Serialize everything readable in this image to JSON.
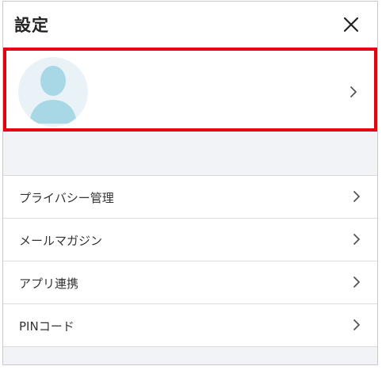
{
  "header": {
    "title": "設定",
    "close_icon": "close-icon"
  },
  "profile": {
    "avatar_icon": "default-avatar-icon",
    "chevron_icon": "chevron-right-icon",
    "highlight_color": "#e60012"
  },
  "menu": {
    "items": [
      {
        "label": "プライバシー管理",
        "icon": "chevron-right-icon"
      },
      {
        "label": "メールマガジン",
        "icon": "chevron-right-icon"
      },
      {
        "label": "アプリ連携",
        "icon": "chevron-right-icon"
      },
      {
        "label": "PINコード",
        "icon": "chevron-right-icon"
      }
    ]
  },
  "colors": {
    "accent": "#e60012",
    "background_gray": "#f2f3f7",
    "avatar_bg": "#e8f2f7",
    "avatar_fg": "#a8d8e6"
  }
}
